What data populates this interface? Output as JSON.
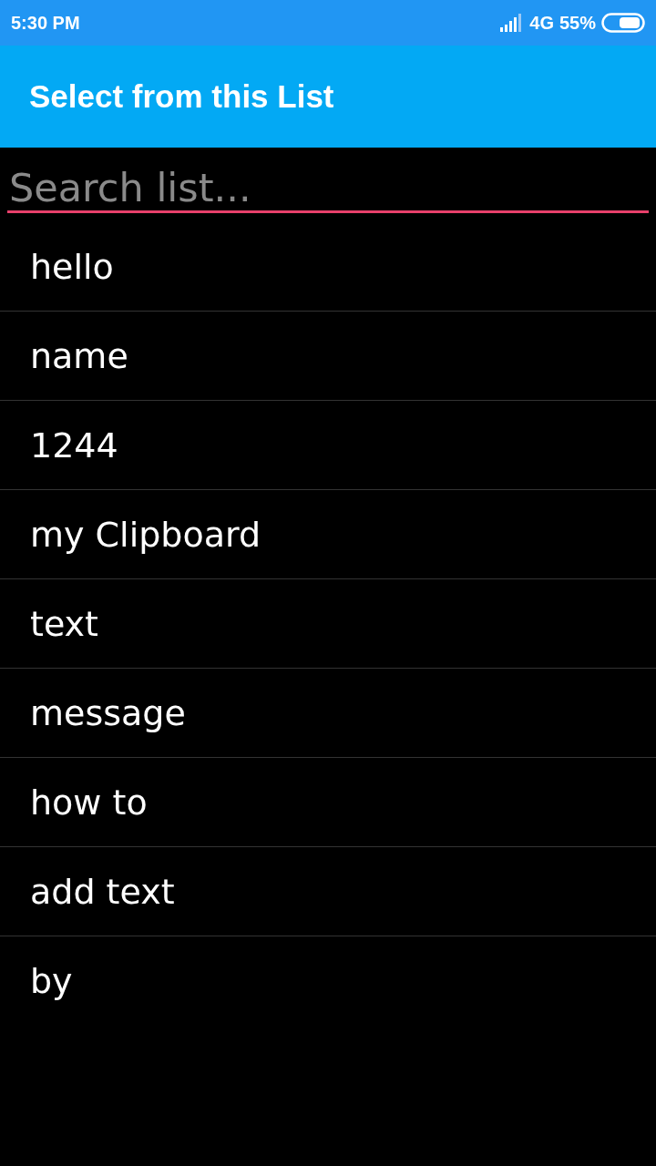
{
  "status_bar": {
    "time": "5:30 PM",
    "network": "4G",
    "battery": "55%"
  },
  "app_bar": {
    "title": "Select from this List"
  },
  "search": {
    "placeholder": "Search list..."
  },
  "items": [
    {
      "label": "hello"
    },
    {
      "label": "name"
    },
    {
      "label": "1244"
    },
    {
      "label": "my Clipboard"
    },
    {
      "label": "text"
    },
    {
      "label": "message"
    },
    {
      "label": "how to"
    },
    {
      "label": "add text"
    },
    {
      "label": "by"
    }
  ]
}
